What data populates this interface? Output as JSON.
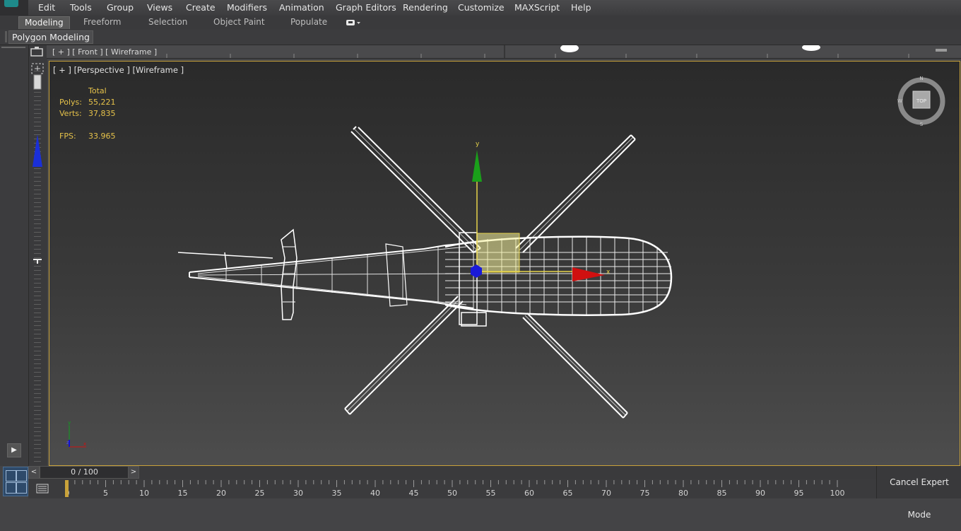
{
  "menu": [
    "Edit",
    "Tools",
    "Group",
    "Views",
    "Create",
    "Modifiers",
    "Animation",
    "Graph Editors",
    "Rendering",
    "Customize",
    "MAXScript",
    "Help"
  ],
  "ribbon": {
    "tabs": [
      "Modeling",
      "Freeform",
      "Selection",
      "Object Paint",
      "Populate"
    ],
    "active_tab": "Modeling",
    "panel_label": "Polygon Modeling"
  },
  "front_viewport": {
    "label": "[ + ] [ Front ] [ Wireframe ]"
  },
  "viewport": {
    "label": "[ + ] [Perspective ] [Wireframe ]",
    "stats": {
      "header": "Total",
      "polys_label": "Polys:",
      "polys": "55,221",
      "verts_label": "Verts:",
      "verts": "37,835",
      "fps_label": "FPS:",
      "fps": "33.965"
    },
    "viewcube_face": "TOP",
    "gizmo": {
      "x": "x",
      "y": "y"
    }
  },
  "timeline": {
    "frame_display": "0 / 100",
    "prev": "<",
    "next": ">",
    "ticks": [
      "0",
      "5",
      "10",
      "15",
      "20",
      "25",
      "30",
      "35",
      "40",
      "45",
      "50",
      "55",
      "60",
      "65",
      "70",
      "75",
      "80",
      "85",
      "90",
      "95",
      "100"
    ]
  },
  "cancel_expert_mode": "Cancel Expert Mode",
  "colors": {
    "viewport_border": "#c9a23a",
    "stat_text": "#e6c24a",
    "x_axis": "#d01010",
    "y_axis": "#10a020",
    "z_axis": "#1010d0"
  }
}
